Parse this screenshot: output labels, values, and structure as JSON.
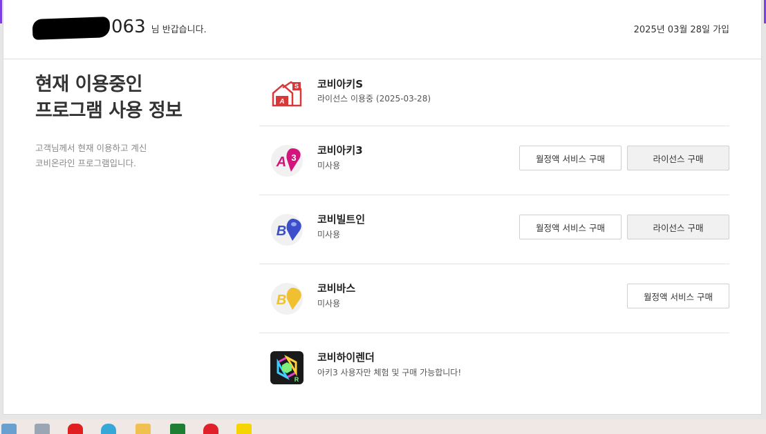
{
  "header": {
    "user_id_suffix": "063",
    "greeting": "님 반갑습니다.",
    "joined": "2025년 03월 28일 가입"
  },
  "left": {
    "title_line1": "현재 이용중인",
    "title_line2": "프로그램 사용 정보",
    "desc_line1": "고객님께서 현재 이용하고 계신",
    "desc_line2": "코비온라인 프로그램입니다."
  },
  "programs": [
    {
      "name": "코비아키S",
      "status": "라이선스 이용중  (2025-03-28)",
      "icon": "kobi-archi-s-icon"
    },
    {
      "name": "코비아키3",
      "status": "미사용",
      "icon": "kobi-archi3-icon",
      "buttons": [
        "월정액 서비스 구매",
        "라이선스 구매"
      ]
    },
    {
      "name": "코비빌트인",
      "status": "미사용",
      "icon": "kobi-builtin-icon",
      "buttons": [
        "월정액 서비스 구매",
        "라이선스 구매"
      ]
    },
    {
      "name": "코비바스",
      "status": "미사용",
      "icon": "kobi-bath-icon",
      "buttons": [
        "월정액 서비스 구매"
      ]
    },
    {
      "name": "코비하이렌더",
      "status": "아키3 사용자만 체험 및 구매 가능합니다!",
      "icon": "kobi-hirender-icon"
    }
  ],
  "colors": {
    "accent_purple": "#7b3fe4",
    "archi_s_red": "#d9383a",
    "archi3_magenta": "#d4147c",
    "builtin_blue": "#3a4fc9",
    "bath_yellow": "#f0c030"
  }
}
